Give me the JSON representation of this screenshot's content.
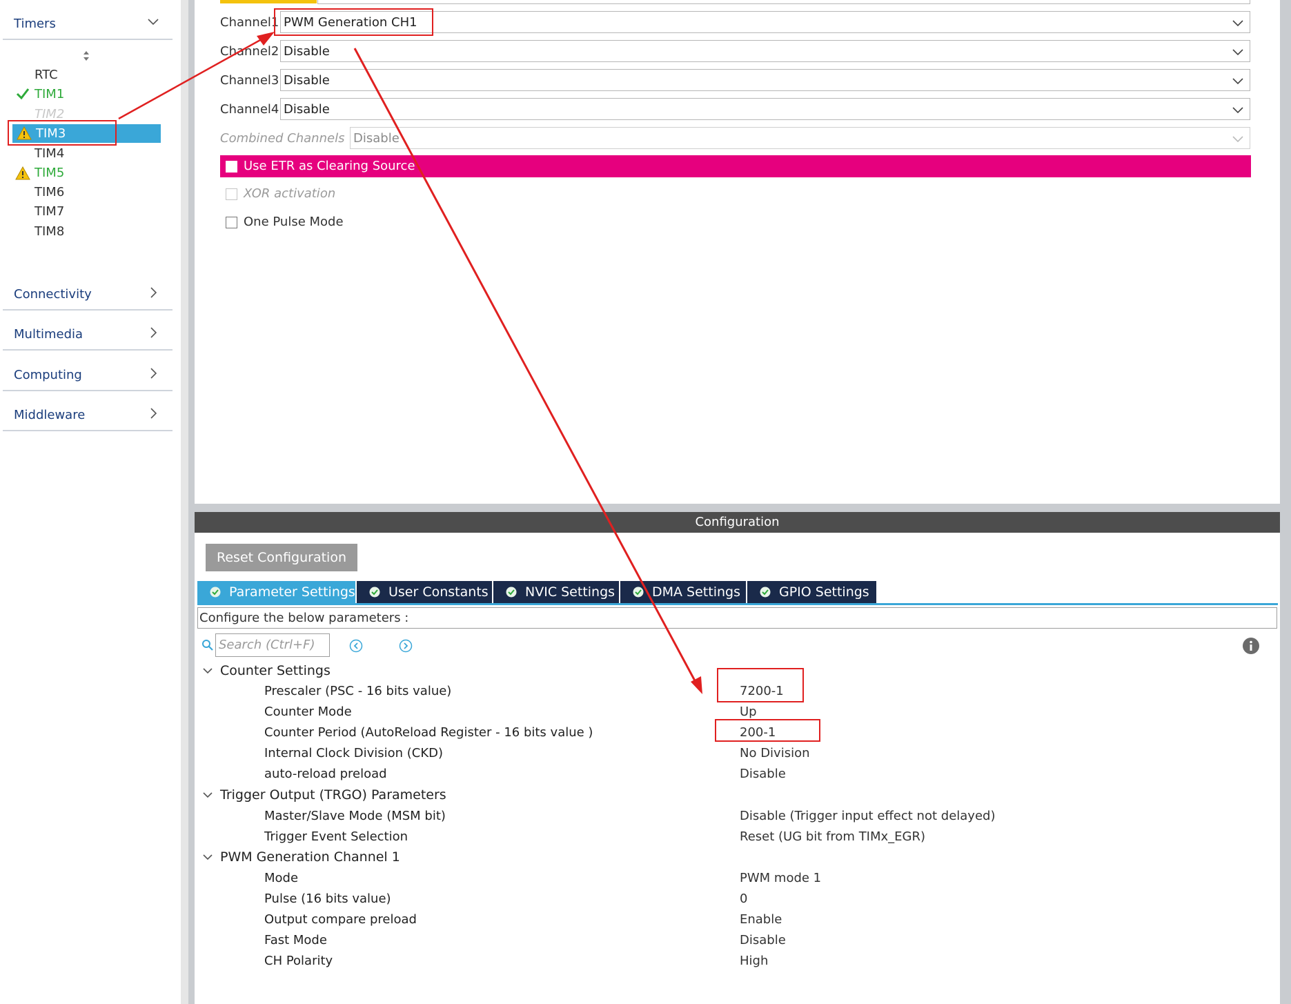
{
  "sidebar": {
    "timers_label": "Timers",
    "timer_items": [
      "RTC",
      "TIM1",
      "TIM2",
      "TIM3",
      "TIM4",
      "TIM5",
      "TIM6",
      "TIM7",
      "TIM8"
    ],
    "categories": [
      "Connectivity",
      "Multimedia",
      "Computing",
      "Middleware"
    ]
  },
  "mode": {
    "channels": [
      {
        "label": "Channel1",
        "value": "PWM Generation CH1"
      },
      {
        "label": "Channel2",
        "value": "Disable"
      },
      {
        "label": "Channel3",
        "value": "Disable"
      },
      {
        "label": "Channel4",
        "value": "Disable"
      }
    ],
    "combined_label": "Combined Channels",
    "combined_value": "Disable",
    "etr_label": "Use ETR as Clearing Source",
    "xor_label": "XOR activation",
    "one_pulse_label": "One Pulse Mode"
  },
  "config": {
    "header": "Configuration",
    "reset_label": "Reset Configuration",
    "tabs": [
      "Parameter Settings",
      "User Constants",
      "NVIC Settings",
      "DMA Settings",
      "GPIO Settings"
    ],
    "description": "Configure the below parameters :",
    "search_placeholder": "Search (Ctrl+F)",
    "groups": [
      {
        "name": "Counter Settings",
        "params": [
          {
            "name": "Prescaler (PSC - 16 bits value)",
            "value": "7200-1"
          },
          {
            "name": "Counter Mode",
            "value": "Up"
          },
          {
            "name": "Counter Period (AutoReload Register - 16 bits value )",
            "value": "200-1"
          },
          {
            "name": "Internal Clock Division (CKD)",
            "value": "No Division"
          },
          {
            "name": "auto-reload preload",
            "value": "Disable"
          }
        ]
      },
      {
        "name": "Trigger Output (TRGO) Parameters",
        "params": [
          {
            "name": "Master/Slave Mode (MSM bit)",
            "value": "Disable (Trigger input effect not delayed)"
          },
          {
            "name": "Trigger Event Selection",
            "value": "Reset (UG bit from TIMx_EGR)"
          }
        ]
      },
      {
        "name": "PWM Generation Channel 1",
        "params": [
          {
            "name": "Mode",
            "value": "PWM mode 1"
          },
          {
            "name": "Pulse (16 bits value)",
            "value": "0"
          },
          {
            "name": "Output compare preload",
            "value": "Enable"
          },
          {
            "name": "Fast Mode",
            "value": "Disable"
          },
          {
            "name": "CH Polarity",
            "value": "High"
          }
        ]
      }
    ]
  },
  "colors": {
    "selected_blue": "#3aa7d8",
    "etr_magenta": "#e6007e",
    "annotation_red": "#e02020",
    "ok_green": "#2eaa3a",
    "tab_dark": "#1a2a4a"
  }
}
